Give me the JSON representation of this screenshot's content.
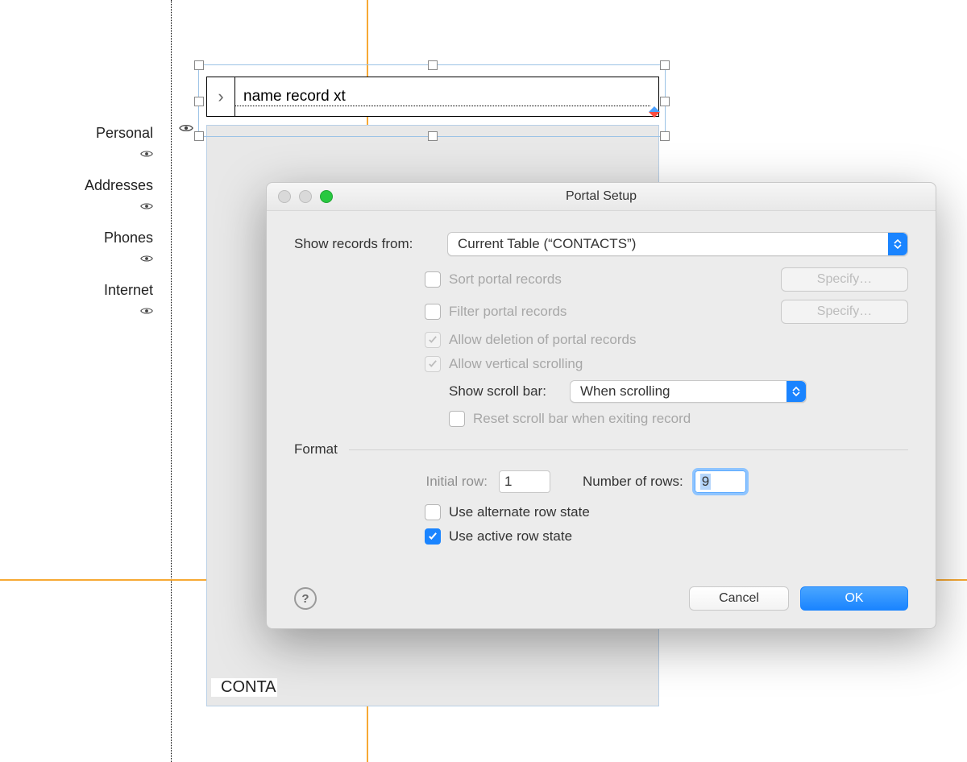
{
  "sidebar": {
    "items": [
      {
        "label": "Personal"
      },
      {
        "label": "Addresses"
      },
      {
        "label": "Phones"
      },
      {
        "label": "Internet"
      }
    ]
  },
  "layout_field": {
    "text": "name record xt"
  },
  "portal_footer": "CONTA",
  "dialog": {
    "title": "Portal Setup",
    "show_records_label": "Show records from:",
    "show_records_value": "Current Table (“CONTACTS”)",
    "sort_label": "Sort portal records",
    "filter_label": "Filter portal records",
    "specify_label": "Specify…",
    "allow_delete_label": "Allow deletion of portal records",
    "allow_scroll_label": "Allow vertical scrolling",
    "scrollbar_label": "Show scroll bar:",
    "scrollbar_value": "When scrolling",
    "reset_label": "Reset scroll bar when exiting record",
    "format_header": "Format",
    "initial_row_label": "Initial row:",
    "initial_row_value": "1",
    "num_rows_label": "Number of rows:",
    "num_rows_value": "9",
    "alt_row_label": "Use alternate row state",
    "active_row_label": "Use active row state",
    "help_glyph": "?",
    "cancel_label": "Cancel",
    "ok_label": "OK"
  }
}
